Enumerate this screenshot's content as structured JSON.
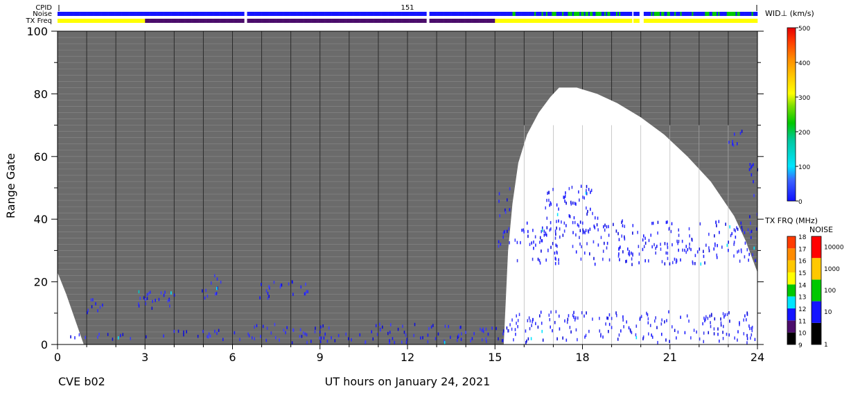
{
  "station_label": "CVE b02",
  "header_rows": {
    "cpid_label": "CPID",
    "noise_label": "Noise",
    "txfreq_label": "TX Freq",
    "cpid_value": "151"
  },
  "chart_data": {
    "type": "heatmap",
    "xlabel": "UT hours on January 24, 2021",
    "ylabel": "Range Gate",
    "xlim": [
      0,
      24
    ],
    "ylim": [
      0,
      100
    ],
    "x_ticks": [
      0,
      3,
      6,
      9,
      12,
      15,
      18,
      21,
      24
    ],
    "x_tick_labels": [
      "0",
      "3",
      "6",
      "9",
      "12",
      "15",
      "18",
      "21",
      "24"
    ],
    "y_ticks": [
      0,
      20,
      40,
      60,
      80,
      100
    ],
    "y_tick_labels": [
      "0",
      "20",
      "40",
      "60",
      "80",
      "100"
    ],
    "background_region_color": "#6b6b6b",
    "white_region_boundary": [
      [
        0,
        23
      ],
      [
        0.3,
        16
      ],
      [
        0.6,
        8
      ],
      [
        0.9,
        0
      ],
      [
        15.3,
        0
      ],
      [
        15.45,
        30
      ],
      [
        15.6,
        45
      ],
      [
        15.8,
        58
      ],
      [
        16.1,
        67
      ],
      [
        16.5,
        74
      ],
      [
        16.9,
        79
      ],
      [
        17.2,
        82
      ],
      [
        17.8,
        82
      ],
      [
        18.5,
        80
      ],
      [
        19.2,
        77
      ],
      [
        20.0,
        72.5
      ],
      [
        20.8,
        67
      ],
      [
        21.6,
        60
      ],
      [
        22.4,
        52
      ],
      [
        23.2,
        41
      ],
      [
        23.6,
        33
      ],
      [
        24,
        23
      ]
    ],
    "scatter_regions": [
      {
        "t": [
          0.1,
          3.1
        ],
        "g": [
          1,
          3
        ],
        "value": 60
      },
      {
        "t": [
          0.8,
          1.6
        ],
        "g": [
          9,
          14
        ],
        "value": 70
      },
      {
        "t": [
          2.6,
          4.4
        ],
        "g": [
          11,
          17
        ],
        "value": 50
      },
      {
        "t": [
          3.5,
          6.3
        ],
        "g": [
          1,
          4
        ],
        "value": 80
      },
      {
        "t": [
          4.9,
          5.6
        ],
        "g": [
          14,
          22
        ],
        "value": 55
      },
      {
        "t": [
          6.5,
          15.6
        ],
        "g": [
          0,
          6
        ],
        "value": 60
      },
      {
        "t": [
          6.9,
          8.6
        ],
        "g": [
          14,
          20
        ],
        "value": 65
      },
      {
        "t": [
          15.1,
          15.5
        ],
        "g": [
          30,
          50
        ],
        "value": 40
      },
      {
        "t": [
          15.6,
          24
        ],
        "g": [
          25,
          39
        ],
        "value": 50
      },
      {
        "t": [
          16.6,
          18.6
        ],
        "g": [
          35,
          50
        ],
        "value": 55
      },
      {
        "t": [
          15.5,
          24
        ],
        "g": [
          0,
          10
        ],
        "value": 45
      },
      {
        "t": [
          22.8,
          23.5
        ],
        "g": [
          63,
          68
        ],
        "value": 60
      },
      {
        "t": [
          23.7,
          24
        ],
        "g": [
          40,
          58
        ],
        "value": 55
      }
    ],
    "noise_bar": {
      "gap_hours": [
        [
          6.35,
          6.45
        ],
        [
          12.65,
          12.75
        ],
        [
          19.7,
          19.75
        ],
        [
          19.95,
          20.1
        ]
      ],
      "green_hours": [
        [
          17.0,
          18.9
        ],
        [
          20.3,
          21.2
        ],
        [
          22.2,
          22.7
        ],
        [
          23.0,
          23.4
        ]
      ]
    },
    "txfreq_bar": {
      "segments": [
        {
          "from": 0,
          "to": 3.0,
          "mhz": 14
        },
        {
          "from": 3.0,
          "to": 15.0,
          "mhz": 10
        },
        {
          "from": 15.0,
          "to": 24,
          "mhz": 14
        }
      ],
      "gap_hours": [
        [
          6.35,
          6.45
        ],
        [
          12.65,
          12.75
        ],
        [
          19.7,
          19.75
        ],
        [
          19.95,
          20.1
        ]
      ]
    },
    "colorbars": [
      {
        "title": "WID⊥ (km/s)",
        "range": [
          0,
          500
        ],
        "ticks": [
          0,
          100,
          200,
          300,
          400,
          500
        ],
        "tick_labels": [
          "0",
          "100",
          "200",
          "300",
          "400",
          "500"
        ]
      },
      {
        "title": "TX FRQ (MHz)",
        "levels": [
          "9",
          "10",
          "11",
          "12",
          "13",
          "14",
          "15",
          "16",
          "17",
          "18"
        ],
        "colors": [
          "#000000",
          "#4b0d6b",
          "#1414ff",
          "#00e5ff",
          "#00c800",
          "#ffff00",
          "#ffc800",
          "#ff8c00",
          "#ff3c00",
          "#e60000"
        ]
      },
      {
        "title": "NOISE",
        "levels": [
          "1",
          "10",
          "100",
          "1000",
          "10000"
        ],
        "colors": [
          "#000000",
          "#1414ff",
          "#00c800",
          "#ffc800",
          "#ff0000"
        ]
      }
    ]
  }
}
